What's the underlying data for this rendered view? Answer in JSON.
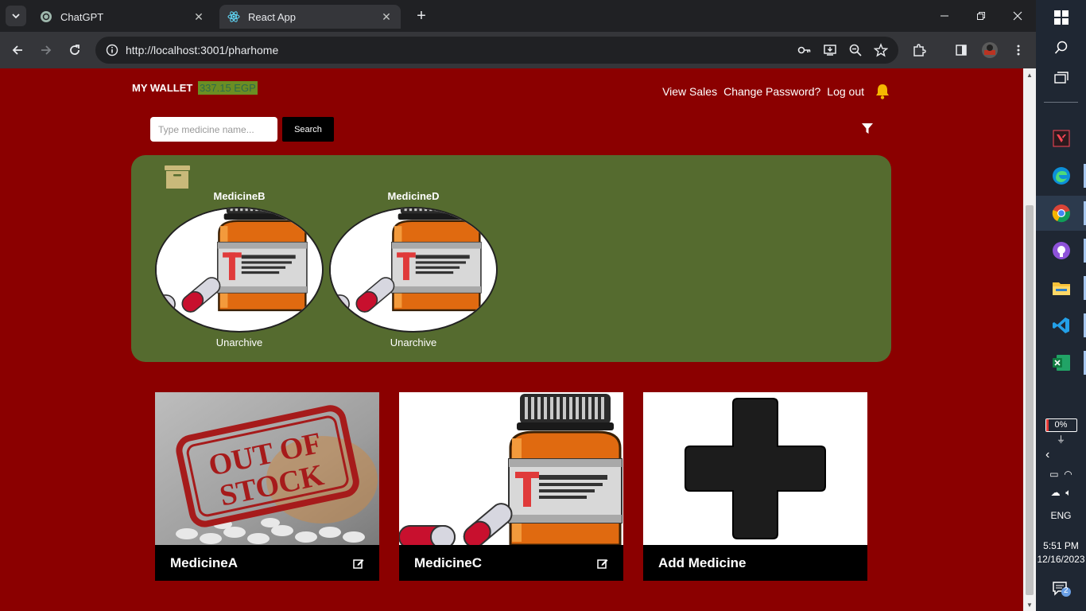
{
  "browser": {
    "tabs": [
      {
        "title": "ChatGPT",
        "active": false
      },
      {
        "title": "React App",
        "active": true
      }
    ],
    "url": "http://localhost:3001/pharhome"
  },
  "page": {
    "wallet_label": "MY WALLET",
    "wallet_amount": "337.15 EGP",
    "nav": {
      "view_sales": "View Sales",
      "change_password": "Change Password?",
      "log_out": "Log out"
    },
    "search": {
      "placeholder": "Type medicine name...",
      "button": "Search"
    },
    "archived": [
      {
        "name": "MedicineB",
        "action": "Unarchive"
      },
      {
        "name": "MedicineD",
        "action": "Unarchive"
      }
    ],
    "cards": [
      {
        "name": "MedicineA",
        "image": "out-of-stock"
      },
      {
        "name": "MedicineC",
        "image": "medicine-bottle"
      },
      {
        "name": "Add Medicine",
        "image": "plus"
      }
    ],
    "out_of_stock_text": [
      "OUT OF",
      "STOCK"
    ]
  },
  "taskbar": {
    "battery": "0%",
    "language": "ENG",
    "time": "5:51 PM",
    "date": "12/16/2023",
    "notifications": "2"
  },
  "colors": {
    "page_bg": "#8b0000",
    "archive_bg": "#556b2f",
    "wallet_highlight": "#6b8e23"
  }
}
